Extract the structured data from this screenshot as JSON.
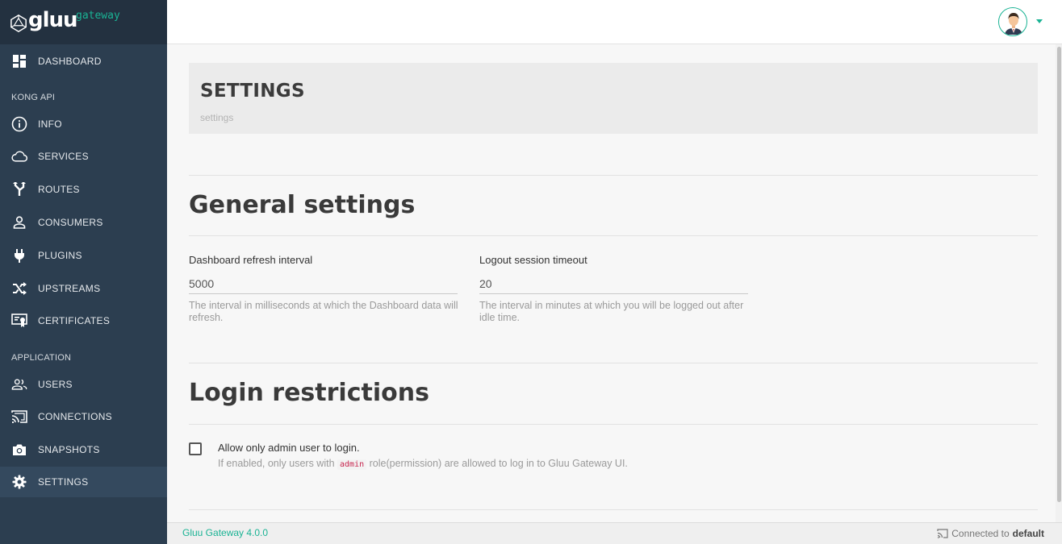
{
  "brand": {
    "name": "gluu",
    "sub": "gateway"
  },
  "sidebar": {
    "dashboard": "DASHBOARD",
    "section_kong": "KONG API",
    "kong_items": [
      {
        "label": "INFO",
        "icon": "info-icon"
      },
      {
        "label": "SERVICES",
        "icon": "cloud-icon"
      },
      {
        "label": "ROUTES",
        "icon": "routes-icon"
      },
      {
        "label": "CONSUMERS",
        "icon": "person-icon"
      },
      {
        "label": "PLUGINS",
        "icon": "plug-icon"
      },
      {
        "label": "UPSTREAMS",
        "icon": "shuffle-icon"
      },
      {
        "label": "CERTIFICATES",
        "icon": "certificate-icon"
      }
    ],
    "section_app": "APPLICATION",
    "app_items": [
      {
        "label": "USERS",
        "icon": "users-icon"
      },
      {
        "label": "CONNECTIONS",
        "icon": "cast-icon"
      },
      {
        "label": "SNAPSHOTS",
        "icon": "camera-icon"
      },
      {
        "label": "SETTINGS",
        "icon": "gear-icon",
        "active": true
      }
    ]
  },
  "header": {
    "title": "SETTINGS",
    "breadcrumb": "settings"
  },
  "general": {
    "title": "General settings",
    "refresh": {
      "label": "Dashboard refresh interval",
      "value": "5000",
      "help": "The interval in milliseconds at which the Dashboard data will refresh."
    },
    "logout": {
      "label": "Logout session timeout",
      "value": "20",
      "help": "The interval in minutes at which you will be logged out after idle time."
    }
  },
  "login": {
    "title": "Login restrictions",
    "checkbox_label": "Allow only admin user to login.",
    "checkbox_checked": false,
    "help_before": "If enabled, only users with",
    "help_code": "admin",
    "help_after": "role(permission) are allowed to log in to Gluu Gateway UI."
  },
  "footer": {
    "version": "Gluu Gateway 4.0.0",
    "connected_prefix": "Connected to",
    "connected_to": "default"
  },
  "colors": {
    "accent": "#1ab394",
    "sidebar": "#2c3e50",
    "sidebar_active": "#34495e"
  }
}
